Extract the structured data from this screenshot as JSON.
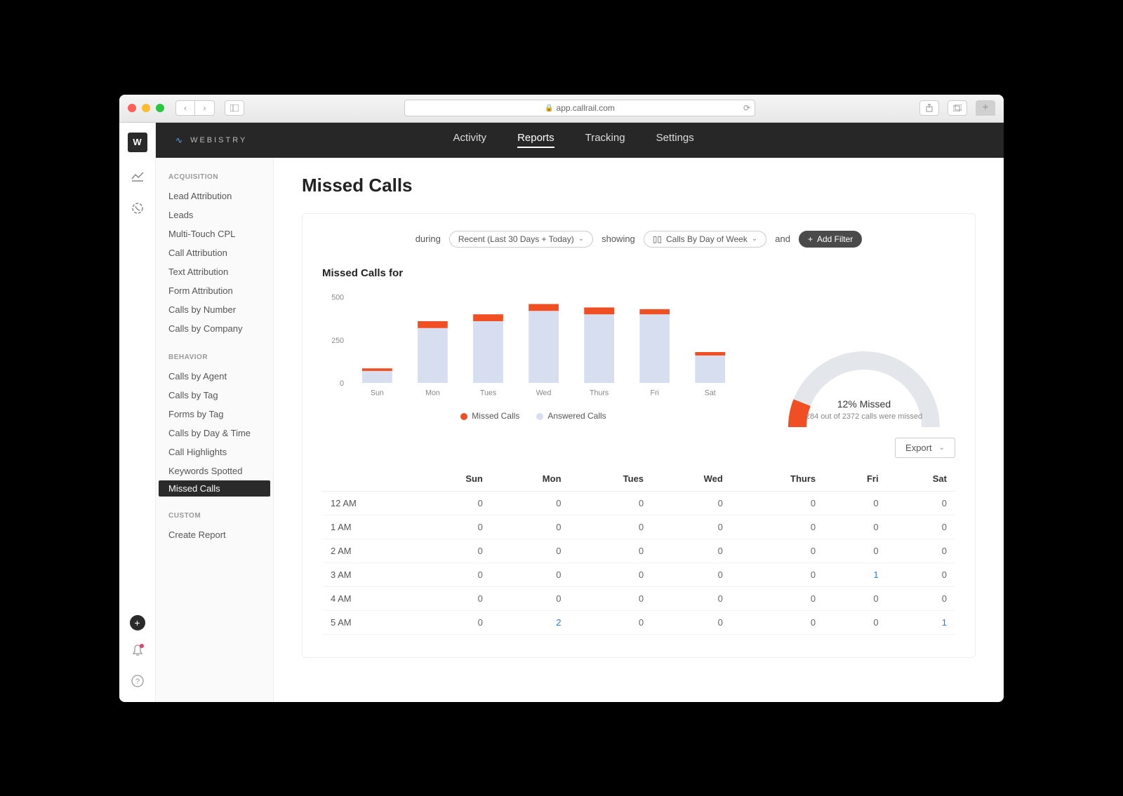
{
  "browser": {
    "url": "app.callrail.com"
  },
  "rail": {
    "logo": "W"
  },
  "brand": "WEBISTRY",
  "nav": {
    "items": [
      "Activity",
      "Reports",
      "Tracking",
      "Settings"
    ],
    "active": 1
  },
  "sidebar": {
    "groups": [
      {
        "heading": "ACQUISITION",
        "items": [
          "Lead Attribution",
          "Leads",
          "Multi-Touch CPL",
          "Call Attribution",
          "Text Attribution",
          "Form Attribution",
          "Calls by Number",
          "Calls by Company"
        ]
      },
      {
        "heading": "BEHAVIOR",
        "items": [
          "Calls by Agent",
          "Calls by Tag",
          "Forms by Tag",
          "Calls by Day & Time",
          "Call Highlights",
          "Keywords Spotted",
          "Missed Calls"
        ]
      },
      {
        "heading": "CUSTOM",
        "items": [
          "Create Report"
        ]
      }
    ],
    "active": "Missed Calls"
  },
  "page": {
    "title": "Missed Calls",
    "filters": {
      "during_label": "during",
      "during_value": "Recent (Last 30 Days + Today)",
      "showing_label": "showing",
      "showing_value": "Calls By Day of Week",
      "and_label": "and",
      "add_filter": "Add Filter"
    },
    "chart_heading": "Missed Calls for",
    "legend": {
      "missed": "Missed Calls",
      "answered": "Answered Calls"
    },
    "gauge": {
      "pct_label": "12% Missed",
      "sub": "284 out of 2372 calls were missed"
    },
    "export": "Export"
  },
  "chart_data": {
    "type": "bar",
    "categories": [
      "Sun",
      "Mon",
      "Tues",
      "Wed",
      "Thurs",
      "Fri",
      "Sat"
    ],
    "series": [
      {
        "name": "Answered Calls",
        "values": [
          70,
          320,
          360,
          420,
          400,
          400,
          160
        ]
      },
      {
        "name": "Missed Calls",
        "values": [
          15,
          40,
          40,
          40,
          40,
          30,
          20
        ]
      }
    ],
    "ylim": [
      0,
      500
    ],
    "yticks": [
      0,
      250,
      500
    ],
    "gauge_pct": 12
  },
  "table": {
    "columns": [
      "",
      "Sun",
      "Mon",
      "Tues",
      "Wed",
      "Thurs",
      "Fri",
      "Sat"
    ],
    "rows": [
      {
        "h": "12 AM",
        "v": [
          0,
          0,
          0,
          0,
          0,
          0,
          0
        ]
      },
      {
        "h": "1 AM",
        "v": [
          0,
          0,
          0,
          0,
          0,
          0,
          0
        ]
      },
      {
        "h": "2 AM",
        "v": [
          0,
          0,
          0,
          0,
          0,
          0,
          0
        ]
      },
      {
        "h": "3 AM",
        "v": [
          0,
          0,
          0,
          0,
          0,
          1,
          0
        ]
      },
      {
        "h": "4 AM",
        "v": [
          0,
          0,
          0,
          0,
          0,
          0,
          0
        ]
      },
      {
        "h": "5 AM",
        "v": [
          0,
          2,
          0,
          0,
          0,
          0,
          1
        ]
      }
    ]
  }
}
